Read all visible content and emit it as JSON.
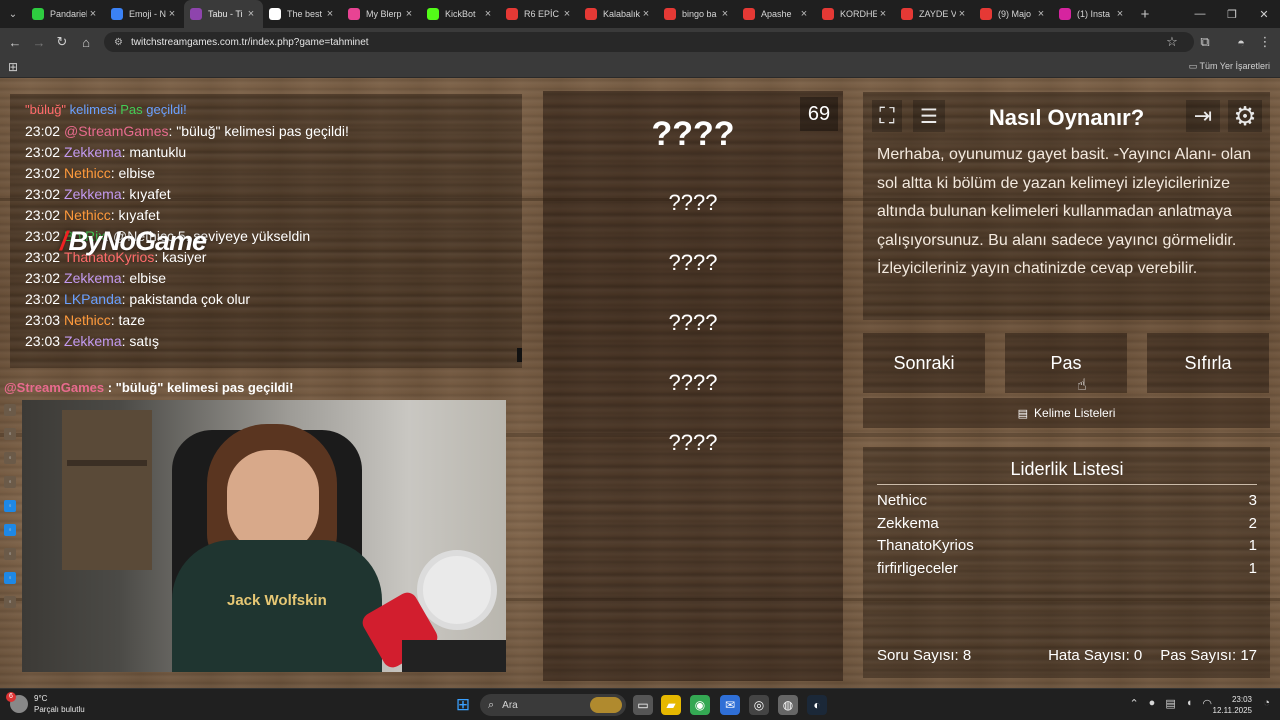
{
  "browser": {
    "tabs": [
      {
        "label": "Pandariel",
        "color": "#2ecc40",
        "active": false
      },
      {
        "label": "Emoji - N",
        "color": "#3b82f6",
        "active": false
      },
      {
        "label": "Tabu - Ti",
        "color": "#8e44ad",
        "active": true
      },
      {
        "label": "The best",
        "color": "#ffffff",
        "active": false
      },
      {
        "label": "My Blerp",
        "color": "#e84393",
        "active": false
      },
      {
        "label": "KickBot",
        "color": "#53fc18",
        "active": false
      },
      {
        "label": "R6 EPİC",
        "color": "#e53935",
        "active": false
      },
      {
        "label": "Kalabalık",
        "color": "#e53935",
        "active": false
      },
      {
        "label": "bingo ba",
        "color": "#e53935",
        "active": false
      },
      {
        "label": "Apashe",
        "color": "#e53935",
        "active": false
      },
      {
        "label": "KORDHE",
        "color": "#e53935",
        "active": false
      },
      {
        "label": "ZAYDE V",
        "color": "#e53935",
        "active": false
      },
      {
        "label": "(9) Majo",
        "color": "#e53935",
        "active": false
      },
      {
        "label": "(1) Insta",
        "color": "#d6249f",
        "active": false
      }
    ],
    "new_tab": "+",
    "url": "twitchstreamgames.com.tr/index.php?game=tahminet",
    "bookmarks_all": "Tüm Yer İşaretleri"
  },
  "chat": {
    "header": [
      {
        "text": "\"büluğ\"",
        "cls": "u-red"
      },
      {
        "text": " kelimesi ",
        "cls": "u-blue"
      },
      {
        "text": "Pas",
        "cls": "u-green"
      },
      {
        "text": " geçildi!",
        "cls": "u-blue"
      }
    ],
    "messages": [
      {
        "time": "23:02",
        "user": "@StreamGames",
        "ucls": "u-pink",
        "text": ": \"büluğ\" kelimesi pas geçildi!"
      },
      {
        "time": "23:02",
        "user": "Zekkema",
        "ucls": "u-purple",
        "text": ": mantuklu"
      },
      {
        "time": "23:02",
        "user": "Nethicc",
        "ucls": "u-orange",
        "text": ": elbise"
      },
      {
        "time": "23:02",
        "user": "Zekkema",
        "ucls": "u-purple",
        "text": ": kıyafet"
      },
      {
        "time": "23:02",
        "user": "Nethicc",
        "ucls": "u-orange",
        "text": ": kıyafet"
      },
      {
        "time": "23:02",
        "user": "BotRix",
        "ucls": "u-green",
        "text": ": @Nethicc 5. seviyeye yükseldin"
      },
      {
        "time": "23:02",
        "user": "ThanatoKyrios",
        "ucls": "u-red",
        "text": ": kasiyer"
      },
      {
        "time": "23:02",
        "user": "Zekkema",
        "ucls": "u-purple",
        "text": ": elbise"
      },
      {
        "time": "23:02",
        "user": "LKPanda",
        "ucls": "u-blue",
        "text": ": pakistanda çok olur"
      },
      {
        "time": "23:03",
        "user": "Nethicc",
        "ucls": "u-orange",
        "text": ": taze"
      },
      {
        "time": "23:03",
        "user": "Zekkema",
        "ucls": "u-purple",
        "text": ": satış"
      }
    ],
    "watermark": "ByNoGame",
    "stream_message_user": "@StreamGames",
    "stream_message_text": " : \"büluğ\" kelimesi pas geçildi!"
  },
  "webcam": {
    "shirt_logo": "Jack Wolfskin"
  },
  "game": {
    "timer": "69",
    "main_word": "????",
    "forbidden_words": [
      "????",
      "????",
      "????",
      "????",
      "????"
    ]
  },
  "howto": {
    "title": "Nasıl Oynanır?",
    "text": "Merhaba, oyunumuz gayet basit. -Yayıncı Alanı- olan sol altta ki bölüm de yazan kelimeyi izleyicilerinize altında bulunan kelimeleri kullanmadan anlatmaya çalışıyorsunuz. Bu alanı sadece yayıncı görmelidir. İzleyicileriniz yayın chatinizde cevap verebilir."
  },
  "buttons": {
    "next": "Sonraki",
    "pass": "Pas",
    "reset": "Sıfırla",
    "word_lists": "Kelime Listeleri"
  },
  "leaderboard": {
    "title": "Liderlik Listesi",
    "rows": [
      {
        "name": "Nethicc",
        "score": "3"
      },
      {
        "name": "Zekkema",
        "score": "2"
      },
      {
        "name": "ThanatoKyrios",
        "score": "1"
      },
      {
        "name": "firfirligeceler",
        "score": "1"
      }
    ]
  },
  "stats": {
    "questions": "Soru Sayısı: 8",
    "errors": "Hata Sayısı: 0",
    "passes": "Pas Sayısı: 17"
  },
  "taskbar": {
    "weather_temp": "9°C",
    "weather_desc": "Parçalı bulutlu",
    "weather_badge": "6",
    "search_placeholder": "Ara",
    "time": "23:03",
    "date": "12.11.2025"
  }
}
